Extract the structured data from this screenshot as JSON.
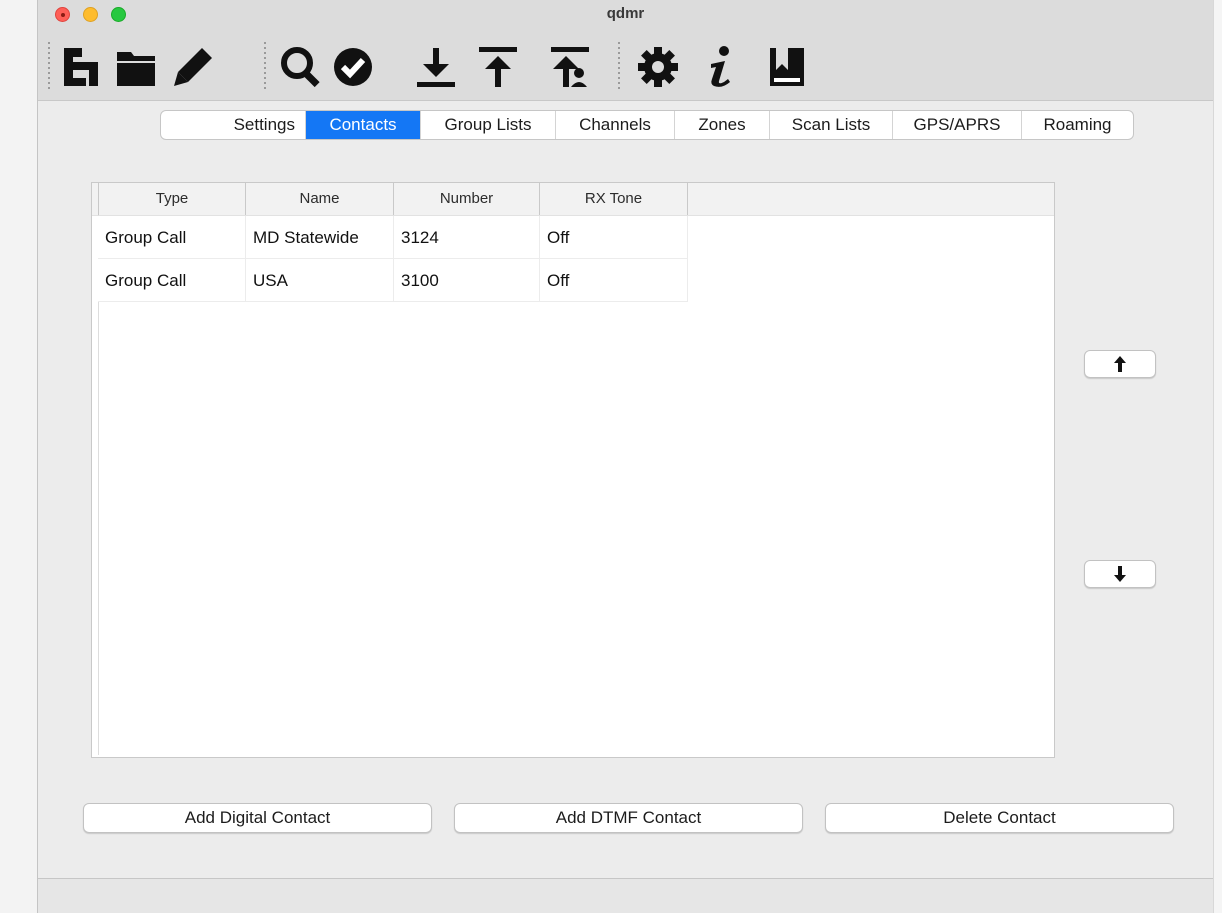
{
  "window": {
    "title": "qdmr"
  },
  "toolbar": {
    "icons": [
      "new-config-icon",
      "open-folder-icon",
      "edit-pencil-icon",
      "search-radio-icon",
      "verify-check-icon",
      "download-icon",
      "upload-icon",
      "upload-callsign-db-icon",
      "settings-gear-icon",
      "info-icon",
      "user-manual-book-icon"
    ]
  },
  "tabs": [
    {
      "label": "Settings",
      "active": false
    },
    {
      "label": "Contacts",
      "active": true
    },
    {
      "label": "Group Lists",
      "active": false
    },
    {
      "label": "Channels",
      "active": false
    },
    {
      "label": "Zones",
      "active": false
    },
    {
      "label": "Scan Lists",
      "active": false
    },
    {
      "label": "GPS/APRS",
      "active": false
    },
    {
      "label": "Roaming",
      "active": false
    }
  ],
  "contacts_table": {
    "columns": [
      "Type",
      "Name",
      "Number",
      "RX Tone"
    ],
    "rows": [
      [
        "Group Call",
        "MD Statewide",
        "3124",
        "Off"
      ],
      [
        "Group Call",
        "USA",
        "3100",
        "Off"
      ]
    ]
  },
  "side_buttons": {
    "move_up_icon": "arrow-up-icon",
    "move_down_icon": "arrow-down-icon"
  },
  "buttons": {
    "add_digital": "Add Digital Contact",
    "add_dtmf": "Add DTMF Contact",
    "delete": "Delete Contact"
  },
  "colors": {
    "tab_active": "#1477f5",
    "close": "#fe5f57",
    "minimize": "#febc2e",
    "zoom": "#28c840"
  }
}
